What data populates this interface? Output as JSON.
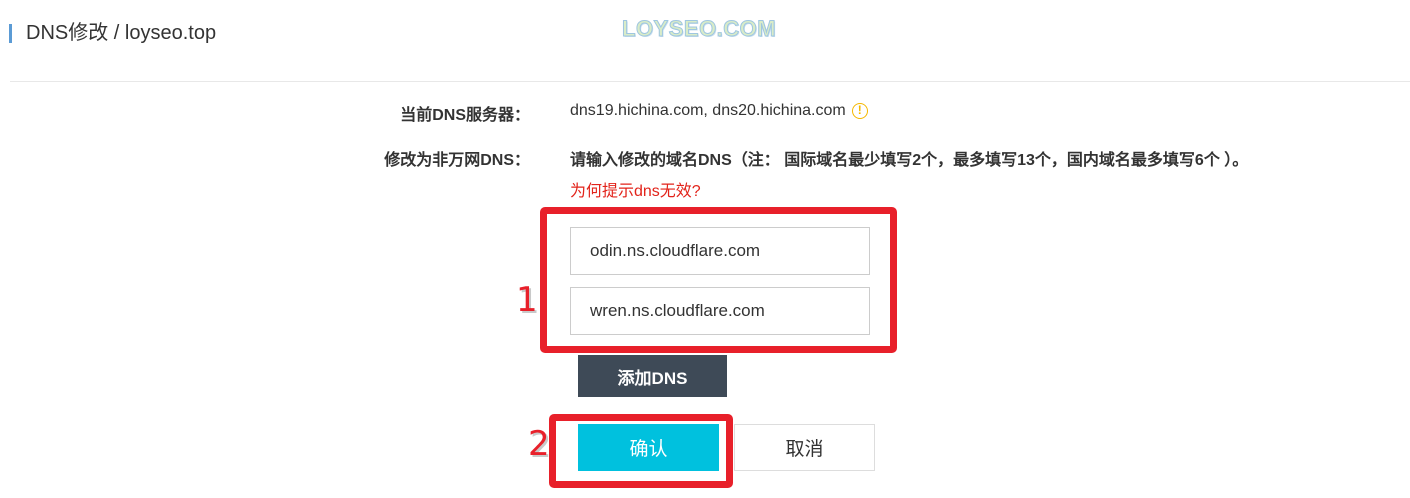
{
  "header": {
    "title": "DNS修改 / loyseo.top",
    "watermark": "LOYSEO.COM"
  },
  "form": {
    "current_dns_label": "当前DNS服务器：",
    "current_dns_value": "dns19.hichina.com, dns20.hichina.com",
    "current_dns_info_icon": "info-icon",
    "change_dns_label": "修改为非万网DNS：",
    "change_dns_hint": "请输入修改的域名DNS（注： 国际域名最少填写2个，最多填写13个，国内域名最多填写6个 ）。",
    "invalid_dns_link": "为何提示dns无效?",
    "dns_inputs": [
      {
        "value": "odin.ns.cloudflare.com"
      },
      {
        "value": "wren.ns.cloudflare.com"
      }
    ],
    "add_dns_button": "添加DNS",
    "confirm_button": "确认",
    "cancel_button": "取消"
  },
  "annotations": {
    "step1": "1",
    "step2": "2",
    "color": "#e8202a"
  },
  "colors": {
    "accent": "#00c1de",
    "dark_button": "#3e4a57",
    "link_red": "#e2231a",
    "warning": "#f5b800"
  }
}
